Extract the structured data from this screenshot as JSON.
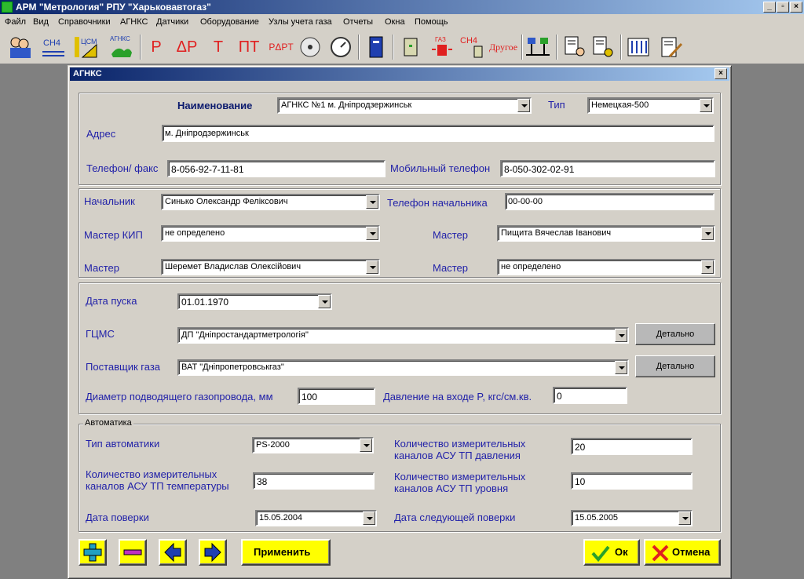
{
  "app": {
    "title": "АРМ \"Метрология\"  РПУ \"Харьковавтогаз\"",
    "window_buttons": [
      "_",
      "🗗",
      "✕"
    ]
  },
  "menu": [
    "Файл",
    "Вид",
    "Справочники",
    "АГНКС",
    "Датчики",
    "Оборудование",
    "Узлы учета газа",
    "Отчеты",
    "Окна",
    "Помощь"
  ],
  "toolbar": {
    "ch4": "CH4",
    "cism": "ЦСМ",
    "agnks": "АГНКС",
    "p": "P",
    "dp": "ΔP",
    "t": "T",
    "pt": "ПТ",
    "prt": "PΔPT",
    "gas": "ГАЗ",
    "ch4b": "CH4",
    "other": "Другое"
  },
  "dialog": {
    "title": "АГНКС",
    "close": "✕",
    "section1": {
      "name_label": "Наименование",
      "name_value": "АГНКС №1 м. Дніпродзержинськ",
      "type_label": "Тип",
      "type_value": "Немецкая-500",
      "address_label": "Адрес",
      "address_value": "м. Дніпродзержинськ",
      "phone_label": "Телефон/ факс",
      "phone_value": "8-056-92-7-11-81",
      "mobile_label": "Мобильный телефон",
      "mobile_value": "8-050-302-02-91"
    },
    "section2": {
      "chief_label": "Начальник",
      "chief_value": "Синько Олександр Феліксович",
      "chief_phone_label": "Телефон начальника",
      "chief_phone_value": "00-00-00",
      "kip_label": "Мастер КИП",
      "kip_value": "не определено",
      "master1_label": "Мастер",
      "master1_value": "Пищита Вячеслав Іванович",
      "master2_label": "Мастер",
      "master2_value": "Шеремет Владислав Олексійович",
      "master3_label": "Мастер",
      "master3_value": "не определено"
    },
    "section3": {
      "start_label": "Дата пуска",
      "start_value": "01.01.1970",
      "gcms_label": "ГЦМС",
      "gcms_value": "ДП \"Дніпростандартметрологія\"",
      "supplier_label": "Поставщик газа",
      "supplier_value": "ВАТ \"Дніпропетровськгаз\"",
      "detail_label": "Детально",
      "diameter_label": "Диаметр подводящего газопровода, мм",
      "diameter_value": "100",
      "pressure_label": "Давление на входе P, кгс/см.кв.",
      "pressure_value": "0"
    },
    "automation": {
      "group_label": "Автоматика",
      "type_label": "Тип автоматики",
      "type_value": "PS-2000",
      "press_channels_label": "Количество измерительных каналов АСУ ТП давления",
      "press_channels_value": "20",
      "temp_channels_label": "Количество измерительных каналов АСУ ТП температуры",
      "temp_channels_value": "38",
      "level_channels_label": "Количество измерительных каналов АСУ ТП уровня",
      "level_channels_value": "10",
      "check_label": "Дата поверки",
      "check_value": "15.05.2004",
      "next_check_label": "Дата следующей поверки",
      "next_check_value": "15.05.2005"
    },
    "buttons": {
      "apply": "Применить",
      "ok": "Ок",
      "cancel": "Отмена"
    }
  },
  "colors": {
    "title_bar": "#0a246a",
    "label_blue": "#1f1fa8",
    "button_yellow": "#ffff00",
    "workspace": "#808080"
  }
}
